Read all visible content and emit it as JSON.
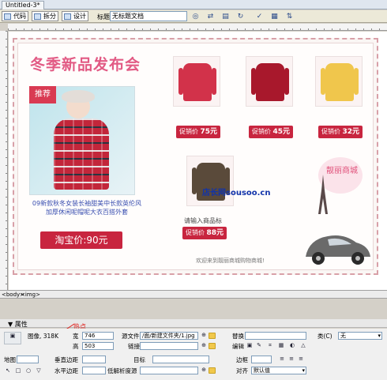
{
  "window": {
    "tab_title": "Untitled-3*"
  },
  "toolbar": {
    "code_label": "代码",
    "split_label": "拆分",
    "design_label": "设计",
    "title_label": "标题:",
    "title_value": "无标题文档",
    "icons": [
      "globe-icon",
      "shuffle-icon",
      "view-options-icon",
      "refresh-icon",
      "check-icon",
      "settings-icon",
      "file-management-icon"
    ]
  },
  "design": {
    "banner": "冬季新品发布会",
    "promo_badge": "推荐",
    "main_caption_1": "09新款秋冬女装长袖甜美中长款英伦风",
    "main_caption_2": "加厚休闲呢帽呢大衣百搭外套",
    "main_price": "淘宝价:90元",
    "products": [
      {
        "price_prefix": "促销价",
        "price_value": "75元",
        "color": "#d2324a"
      },
      {
        "price_prefix": "促销价",
        "price_value": "45元",
        "color": "#a8182c"
      },
      {
        "price_prefix": "促销价",
        "price_value": "32元",
        "color": "#f0c64c"
      },
      {
        "price_prefix": "促销价",
        "price_value": "88元",
        "color": "#5a4a3a"
      }
    ],
    "placeholder_caption": "请输入商品标",
    "deco_text": "靓丽商城",
    "site_watermark": "店长网sousoo.cn",
    "footer_text": "欢迎来到靓丽商城购物商城!"
  },
  "tagbar": {
    "body_tag": "<body>",
    "img_tag": "<img>"
  },
  "properties": {
    "panel_title": "属性",
    "hotspot_label": "热点",
    "image_label": "图像, 318K",
    "width_label": "宽",
    "width_value": "746",
    "height_label": "高",
    "height_value": "503",
    "src_label": "源文件",
    "src_value": "/面/新建文件夹/1.jpg",
    "link_label": "链接",
    "link_value": "",
    "alt_label": "替换",
    "edit_label": "编辑",
    "class_label": "类(C)",
    "class_value": "无",
    "map_label": "地图",
    "vspace_label": "垂直边距",
    "hspace_label": "水平边距",
    "target_label": "目标",
    "lowsrc_label": "低解析度源",
    "border_label": "边框",
    "align_label": "对齐",
    "align_value": "默认值"
  }
}
